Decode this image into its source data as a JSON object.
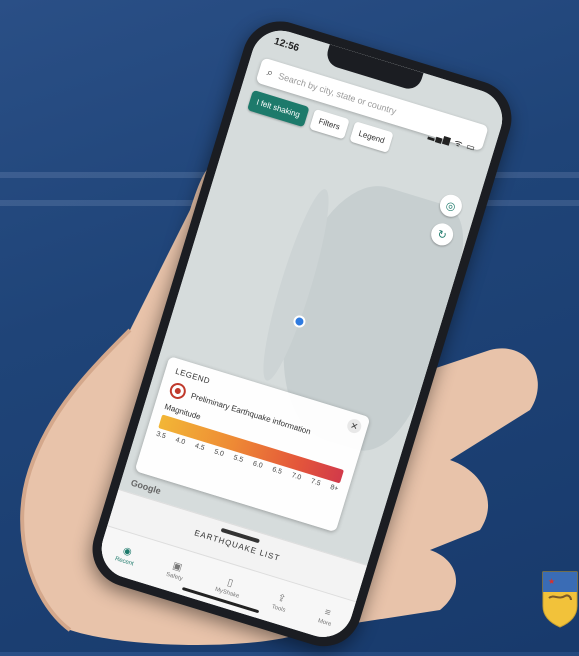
{
  "status": {
    "time": "12:56",
    "signal": "▂▄▆ ᯤ ▭"
  },
  "search": {
    "placeholder": "Search by city, state or country"
  },
  "chips": {
    "felt_shaking": "I felt shaking",
    "filters": "Filters",
    "legend": "Legend"
  },
  "legend": {
    "title": "LEGEND",
    "preliminary_label": "Preliminary Earthquake information",
    "magnitude_label": "Magnitude",
    "ticks": [
      "3.5",
      "4.0",
      "4.5",
      "5.0",
      "5.5",
      "6.0",
      "6.5",
      "7.0",
      "7.5",
      "8+"
    ]
  },
  "map": {
    "attribution": "Google"
  },
  "sheet": {
    "title": "EARTHQUAKE LIST"
  },
  "tabs": [
    {
      "label": "Recent",
      "icon": "◉"
    },
    {
      "label": "Safety",
      "icon": "▣"
    },
    {
      "label": "MyShake",
      "icon": "▯"
    },
    {
      "label": "Tools",
      "icon": "⇪"
    },
    {
      "label": "More",
      "icon": "≡"
    }
  ],
  "colors": {
    "accent": "#1d7a6b",
    "marker": "#2f7be0",
    "quake": "#c0392b"
  },
  "icons": {
    "search": "search-icon",
    "locate": "locate-icon",
    "refresh": "refresh-icon",
    "close": "close-icon"
  }
}
